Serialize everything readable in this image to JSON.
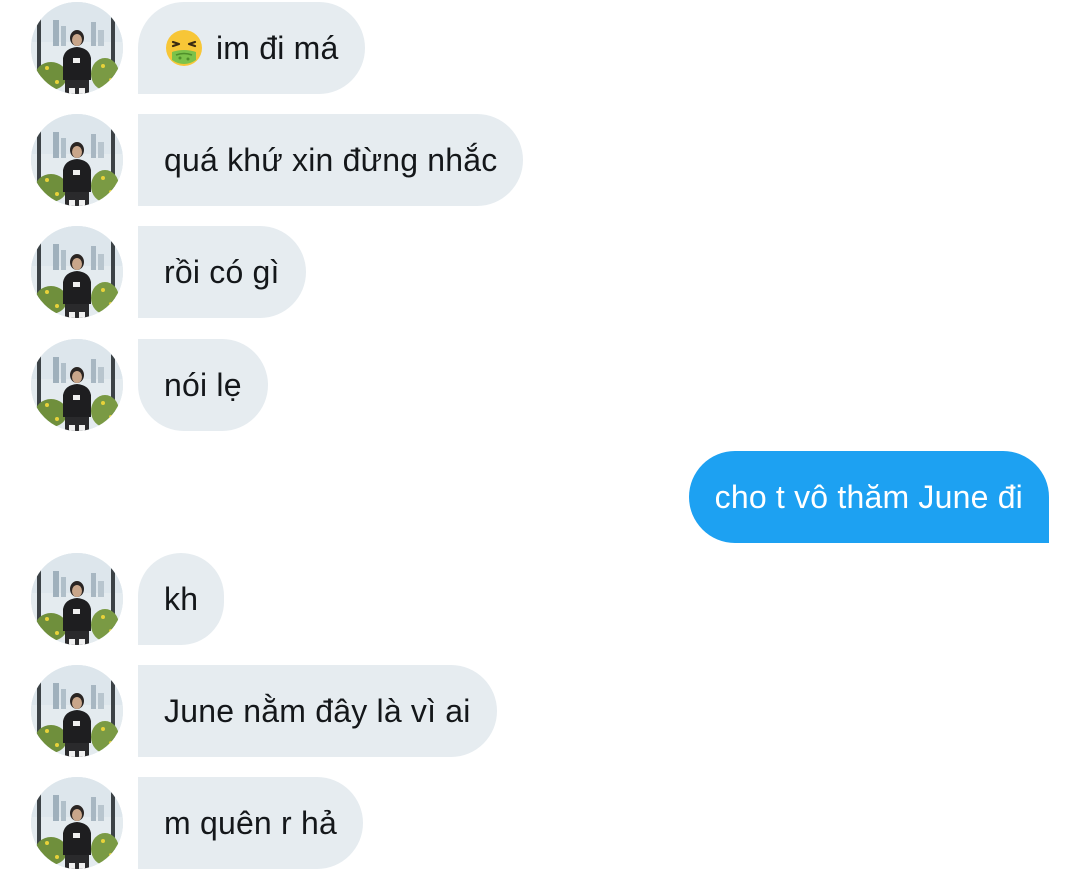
{
  "messages": [
    {
      "from": "them",
      "text": "im đi má",
      "emoji": "nauseated-face"
    },
    {
      "from": "them",
      "text": "quá khứ xin đừng nhắc"
    },
    {
      "from": "them",
      "text": "rồi có gì"
    },
    {
      "from": "them",
      "text": "nói lẹ"
    },
    {
      "from": "me",
      "text": "cho t vô thăm June đi"
    },
    {
      "from": "them",
      "text": "kh"
    },
    {
      "from": "them",
      "text": "June nằm đây là vì ai"
    },
    {
      "from": "them",
      "text": "m quên r hả"
    }
  ],
  "colors": {
    "incoming_bubble": "#e6ecf0",
    "outgoing_bubble": "#1da1f2",
    "incoming_text": "#14171a",
    "outgoing_text": "#ffffff"
  }
}
